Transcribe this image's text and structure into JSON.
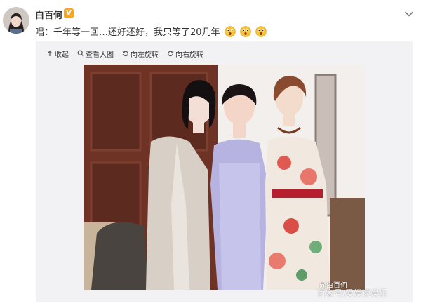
{
  "post": {
    "username": "白百何",
    "verified_badge": "V",
    "text": "唱：千年等一回…还好还好，我只等了20几年",
    "emoji_count": 3,
    "emoji_icon": "surprised-face-icon"
  },
  "toolbar": {
    "collect_label": "收起",
    "view_large_label": "查看大图",
    "rotate_left_label": "向左旋转",
    "rotate_right_label": "向右旋转"
  },
  "photo": {
    "watermark_handle": "@白百何",
    "watermark_source": "百家号/爱娱读娱乐"
  },
  "colors": {
    "badge": "#f6a623",
    "media_background": "#f2f2f5",
    "text": "#333333"
  }
}
